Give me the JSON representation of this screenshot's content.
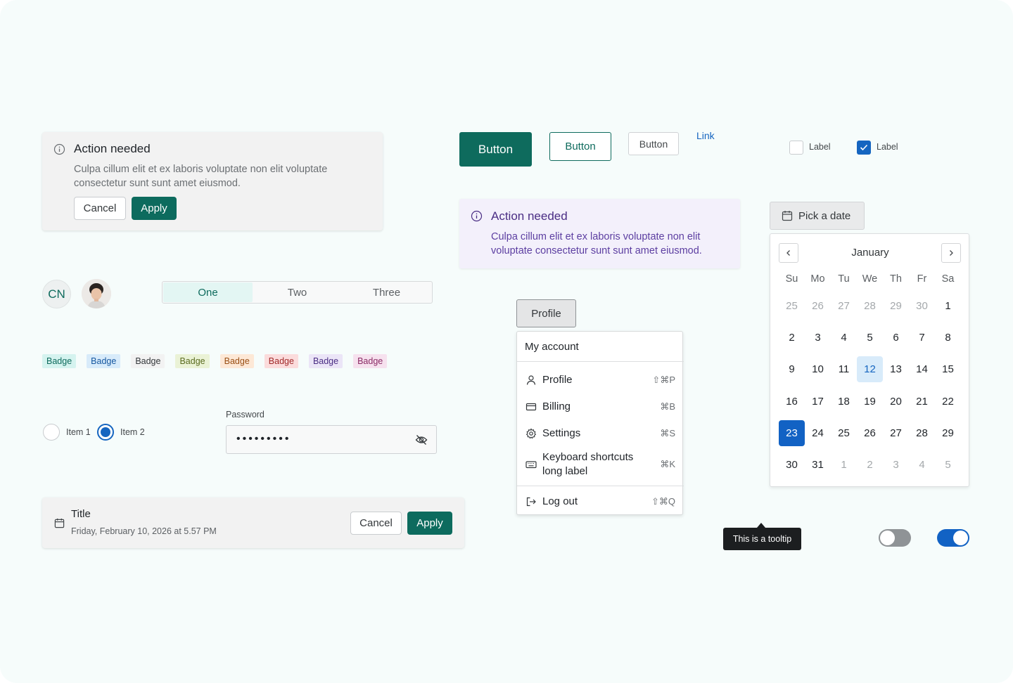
{
  "alert_card": {
    "title": "Action needed",
    "message": "Culpa cillum elit et ex laboris voluptate non elit voluptate consectetur sunt sunt amet eiusmod.",
    "cancel_label": "Cancel",
    "apply_label": "Apply",
    "icon": "info-icon"
  },
  "buttons": {
    "primary_label": "Button",
    "outline_label": "Button",
    "secondary_label": "Button",
    "link_label": "Link"
  },
  "checkboxes": [
    {
      "label": "Label",
      "checked": false
    },
    {
      "label": "Label",
      "checked": true
    }
  ],
  "alert_purple": {
    "title": "Action needed",
    "message": "Culpa cillum elit et ex laboris voluptate non elit voluptate consectetur sunt sunt amet eiusmod.",
    "icon": "info-icon"
  },
  "date_picker": {
    "trigger_label": "Pick a date",
    "month": "January",
    "weekdays": [
      "Su",
      "Mo",
      "Tu",
      "We",
      "Th",
      "Fr",
      "Sa"
    ],
    "days": [
      {
        "d": "25",
        "muted": true
      },
      {
        "d": "26",
        "muted": true
      },
      {
        "d": "27",
        "muted": true
      },
      {
        "d": "28",
        "muted": true
      },
      {
        "d": "29",
        "muted": true
      },
      {
        "d": "30",
        "muted": true
      },
      {
        "d": "1"
      },
      {
        "d": "2"
      },
      {
        "d": "3"
      },
      {
        "d": "4"
      },
      {
        "d": "5"
      },
      {
        "d": "6"
      },
      {
        "d": "7"
      },
      {
        "d": "8"
      },
      {
        "d": "9"
      },
      {
        "d": "10"
      },
      {
        "d": "11"
      },
      {
        "d": "12",
        "today": true
      },
      {
        "d": "13"
      },
      {
        "d": "14"
      },
      {
        "d": "15"
      },
      {
        "d": "16"
      },
      {
        "d": "17"
      },
      {
        "d": "18"
      },
      {
        "d": "19"
      },
      {
        "d": "20"
      },
      {
        "d": "21"
      },
      {
        "d": "22"
      },
      {
        "d": "23",
        "selected": true
      },
      {
        "d": "24"
      },
      {
        "d": "25"
      },
      {
        "d": "26"
      },
      {
        "d": "27"
      },
      {
        "d": "28"
      },
      {
        "d": "29"
      },
      {
        "d": "30"
      },
      {
        "d": "31"
      },
      {
        "d": "1",
        "muted": true
      },
      {
        "d": "2",
        "muted": true
      },
      {
        "d": "3",
        "muted": true
      },
      {
        "d": "4",
        "muted": true
      },
      {
        "d": "5",
        "muted": true
      }
    ]
  },
  "avatars": {
    "initials": "CN"
  },
  "segment": {
    "items": [
      "One",
      "Two",
      "Three"
    ],
    "active": "One"
  },
  "badges": [
    {
      "label": "Badge",
      "bg": "#d5f3ef",
      "fg": "#0e6b5d"
    },
    {
      "label": "Badge",
      "bg": "#d8ebfa",
      "fg": "#1557a0"
    },
    {
      "label": "Badge",
      "bg": "#f2f2f2",
      "fg": "#33373a"
    },
    {
      "label": "Badge",
      "bg": "#eaf2d6",
      "fg": "#5a6b1f"
    },
    {
      "label": "Badge",
      "bg": "#fde8d6",
      "fg": "#9a4f14"
    },
    {
      "label": "Badge",
      "bg": "#fbdcdc",
      "fg": "#a12a2a"
    },
    {
      "label": "Badge",
      "bg": "#ebe5f7",
      "fg": "#4a2d84"
    },
    {
      "label": "Badge",
      "bg": "#f6e1ee",
      "fg": "#8a2a65"
    }
  ],
  "radios": [
    {
      "label": "Item 1",
      "checked": false
    },
    {
      "label": "Item 2",
      "checked": true
    }
  ],
  "password": {
    "label": "Password",
    "value": "•••••••••"
  },
  "title_card": {
    "title": "Title",
    "subtitle": "Friday, February 10, 2026 at 5.57 PM",
    "cancel_label": "Cancel",
    "apply_label": "Apply"
  },
  "menu": {
    "trigger_label": "Profile",
    "heading": "My account",
    "items": [
      {
        "label": "Profile",
        "shortcut": "⇧⌘P",
        "icon": "user-icon"
      },
      {
        "label": "Billing",
        "shortcut": "⌘B",
        "icon": "credit-card-icon"
      },
      {
        "label": "Settings",
        "shortcut": "⌘S",
        "icon": "gear-icon"
      },
      {
        "label": "Keyboard shortcuts long label",
        "shortcut": "⌘K",
        "icon": "keyboard-icon"
      },
      {
        "label": "Log out",
        "shortcut": "⇧⌘Q",
        "icon": "logout-icon"
      }
    ]
  },
  "tooltip": {
    "text": "This is a tooltip"
  },
  "toggles": [
    {
      "on": false
    },
    {
      "on": true
    }
  ],
  "colors": {
    "primary_green": "#0e6b5d",
    "accent_blue": "#1565c0",
    "purple_text": "#4a2d84"
  }
}
